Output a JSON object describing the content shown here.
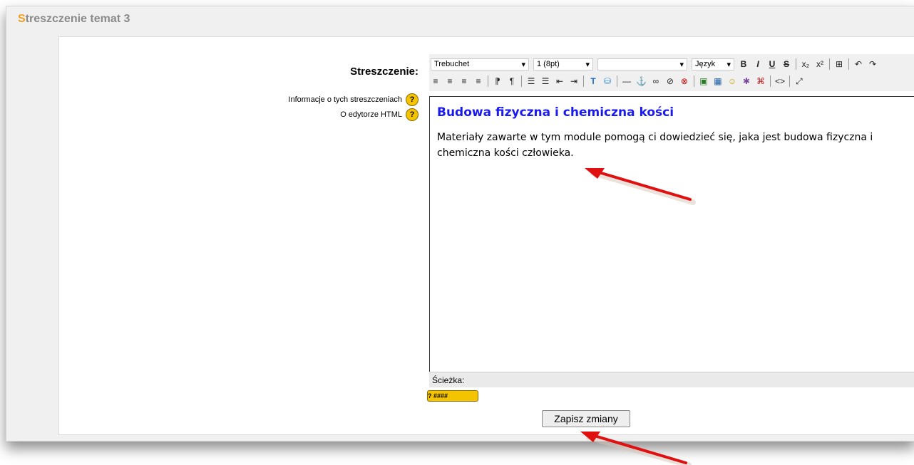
{
  "section": {
    "title_first_letter": "S",
    "title_rest": "treszczenie temat 3"
  },
  "form": {
    "field_label": "Streszczenie:",
    "help_links": [
      {
        "label": "Informacje o tych streszczeniach",
        "icon": "help-icon"
      },
      {
        "label": "O edytorze HTML",
        "icon": "help-icon"
      }
    ],
    "help_glyph": "?"
  },
  "toolbar": {
    "font_family": "Trebuchet",
    "font_size": "1 (8pt)",
    "format": "",
    "language": "Język",
    "dropdown_glyph": "▾",
    "buttons_row1": [
      "B",
      "I",
      "U",
      "S",
      "x₂",
      "x²",
      "⊞",
      "↶",
      "↷"
    ],
    "buttons_row2": [
      "≡",
      "≡",
      "≡",
      "≡",
      "⁋",
      "¶",
      "☰",
      "☰",
      "⇤",
      "⇥",
      "T",
      "⛁",
      "—",
      "⚓",
      "∞",
      "⊘",
      "⊗",
      "▣",
      "▦",
      "☺",
      "✱",
      "⌘",
      "<>",
      "⤢"
    ]
  },
  "editor": {
    "heading": "Budowa fizyczna i chemiczna kości",
    "body": "Materiały zawarte w tym module pomogą ci dowiedzieć się, jaka jest budowa fizyczna i chemiczna kości człowieka."
  },
  "status": {
    "path_label": "Ścieżka:"
  },
  "keyboard_button": {
    "label": "? ####"
  },
  "actions": {
    "save_label": "Zapisz zmiany"
  },
  "colors": {
    "heading_accent": "#f0a020",
    "editor_heading": "#1a1aee",
    "annotation_arrow": "#e01010"
  }
}
